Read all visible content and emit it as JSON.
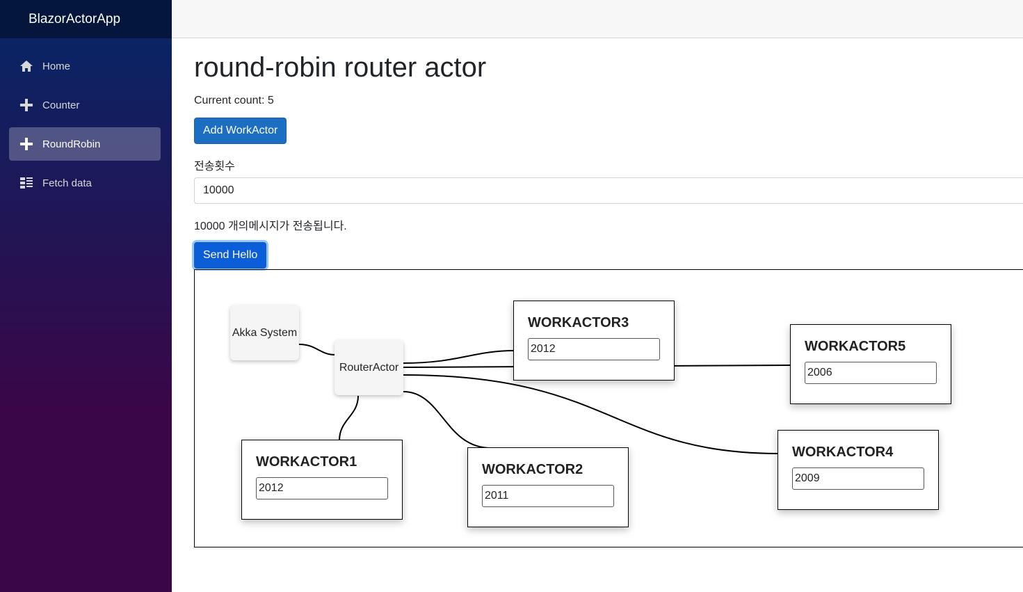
{
  "sidebar": {
    "brand": "BlazorActorApp",
    "items": [
      {
        "label": "Home",
        "icon": "home-icon"
      },
      {
        "label": "Counter",
        "icon": "plus-icon"
      },
      {
        "label": "RoundRobin",
        "icon": "plus-icon",
        "active": true
      },
      {
        "label": "Fetch data",
        "icon": "list-icon"
      }
    ]
  },
  "main": {
    "title": "round-robin router actor",
    "count_text": "Current count: 5",
    "add_button": "Add WorkActor",
    "send_label": "전송횟수",
    "send_value": "10000",
    "message": "10000 개의메시지가 전송됩니다.",
    "send_button": "Send Hello"
  },
  "diagram": {
    "akka": "Akka System",
    "router": "RouterActor",
    "workers": [
      {
        "name": "WORKACTOR1",
        "value": "2012"
      },
      {
        "name": "WORKACTOR2",
        "value": "2011"
      },
      {
        "name": "WORKACTOR3",
        "value": "2012"
      },
      {
        "name": "WORKACTOR4",
        "value": "2009"
      },
      {
        "name": "WORKACTOR5",
        "value": "2006"
      }
    ]
  },
  "colors": {
    "primary": "#1b6ec2",
    "sidebar_top": "#052767",
    "sidebar_bottom": "#3a0647"
  }
}
